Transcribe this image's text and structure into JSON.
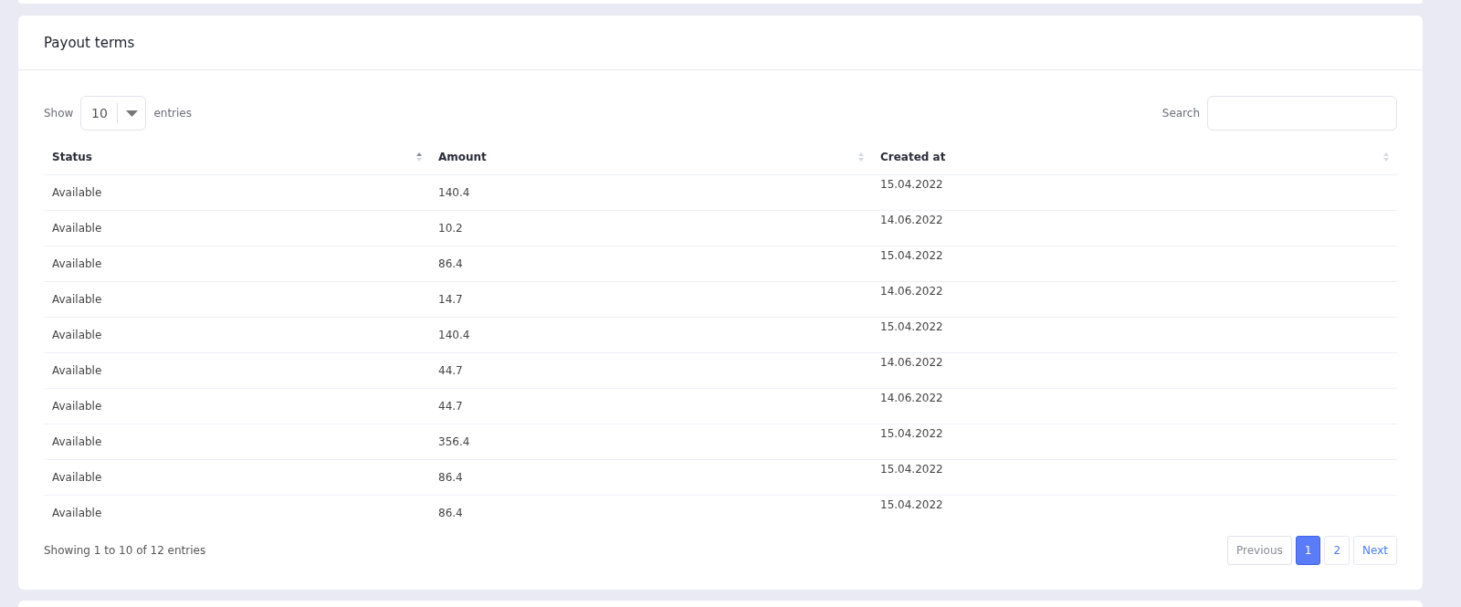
{
  "card": {
    "title": "Payout terms"
  },
  "length_menu": {
    "label_before": "Show",
    "value": "10",
    "label_after": "entries"
  },
  "search": {
    "label": "Search"
  },
  "table": {
    "columns": [
      {
        "label": "Status",
        "sorted": true
      },
      {
        "label": "Amount",
        "sorted": false
      },
      {
        "label": "Created at",
        "sorted": false
      }
    ],
    "rows": [
      [
        "Available",
        "140.4",
        "15.04.2022"
      ],
      [
        "Available",
        "10.2",
        "14.06.2022"
      ],
      [
        "Available",
        "86.4",
        "15.04.2022"
      ],
      [
        "Available",
        "14.7",
        "14.06.2022"
      ],
      [
        "Available",
        "140.4",
        "15.04.2022"
      ],
      [
        "Available",
        "44.7",
        "14.06.2022"
      ],
      [
        "Available",
        "44.7",
        "14.06.2022"
      ],
      [
        "Available",
        "356.4",
        "15.04.2022"
      ],
      [
        "Available",
        "86.4",
        "15.04.2022"
      ],
      [
        "Available",
        "86.4",
        "15.04.2022"
      ]
    ]
  },
  "info": "Showing 1 to 10 of 12 entries",
  "pagination": {
    "previous": "Previous",
    "next": "Next",
    "pages": [
      {
        "label": "1",
        "selected": true
      },
      {
        "label": "2",
        "selected": false
      }
    ]
  }
}
